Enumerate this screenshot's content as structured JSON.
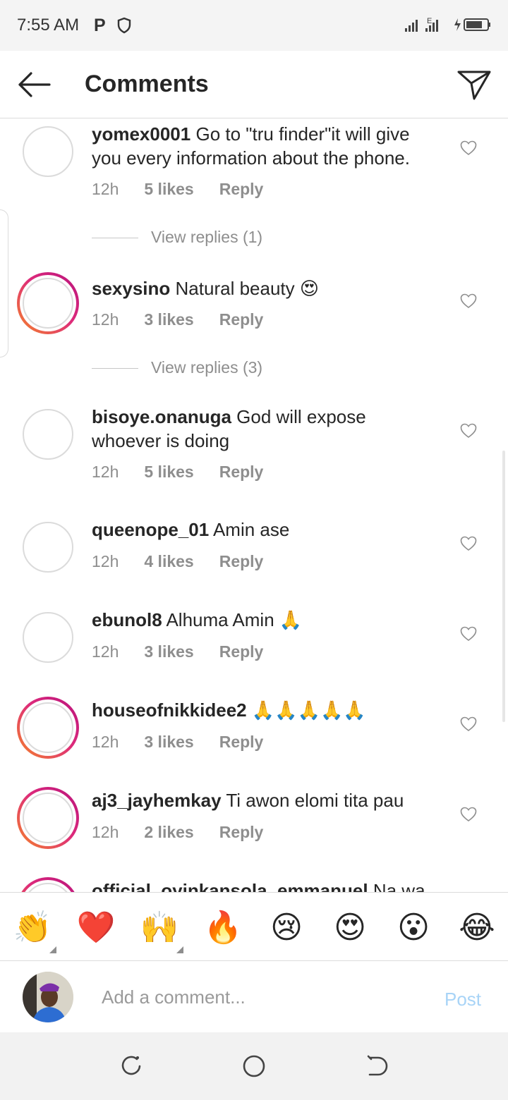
{
  "status_bar": {
    "time": "7:55 AM",
    "p_icon": "P",
    "network": "E"
  },
  "header": {
    "title": "Comments"
  },
  "comments": [
    {
      "username": "yomex0001",
      "text": "Go to \"tru finder\"it will give you every information about the phone.",
      "time": "12h",
      "likes": "5 likes",
      "reply": "Reply",
      "story_ring": false,
      "view_replies": "View replies (1)"
    },
    {
      "username": "sexysino",
      "text": "Natural beauty 😍",
      "time": "12h",
      "likes": "3 likes",
      "reply": "Reply",
      "story_ring": true,
      "view_replies": "View replies (3)"
    },
    {
      "username": "bisoye.onanuga",
      "text": "God will expose whoever is doing",
      "time": "12h",
      "likes": "5 likes",
      "reply": "Reply",
      "story_ring": false
    },
    {
      "username": "queenope_01",
      "text": "Amin ase",
      "time": "12h",
      "likes": "4 likes",
      "reply": "Reply",
      "story_ring": false
    },
    {
      "username": "ebunol8",
      "text": "Alhuma Amin 🙏",
      "time": "12h",
      "likes": "3 likes",
      "reply": "Reply",
      "story_ring": false
    },
    {
      "username": "houseofnikkidee2",
      "text": "🙏🙏🙏🙏🙏",
      "time": "12h",
      "likes": "3 likes",
      "reply": "Reply",
      "story_ring": true
    },
    {
      "username": "aj3_jayhemkay",
      "text": "Ti awon elomi tita pau",
      "time": "12h",
      "likes": "2 likes",
      "reply": "Reply",
      "story_ring": true
    },
    {
      "username": "official_oyinkansola_emmanuel",
      "text": "Na wa",
      "story_ring": true
    }
  ],
  "emoji_bar": [
    "👏",
    "❤️",
    "🙌",
    "🔥",
    "😢",
    "😍",
    "😮",
    "😂"
  ],
  "composer": {
    "placeholder": "Add a comment...",
    "post_label": "Post"
  },
  "colors": {
    "post_disabled": "#a8d4f7",
    "text_secondary": "#8e8e8e",
    "heart_red": "#e0245e"
  }
}
